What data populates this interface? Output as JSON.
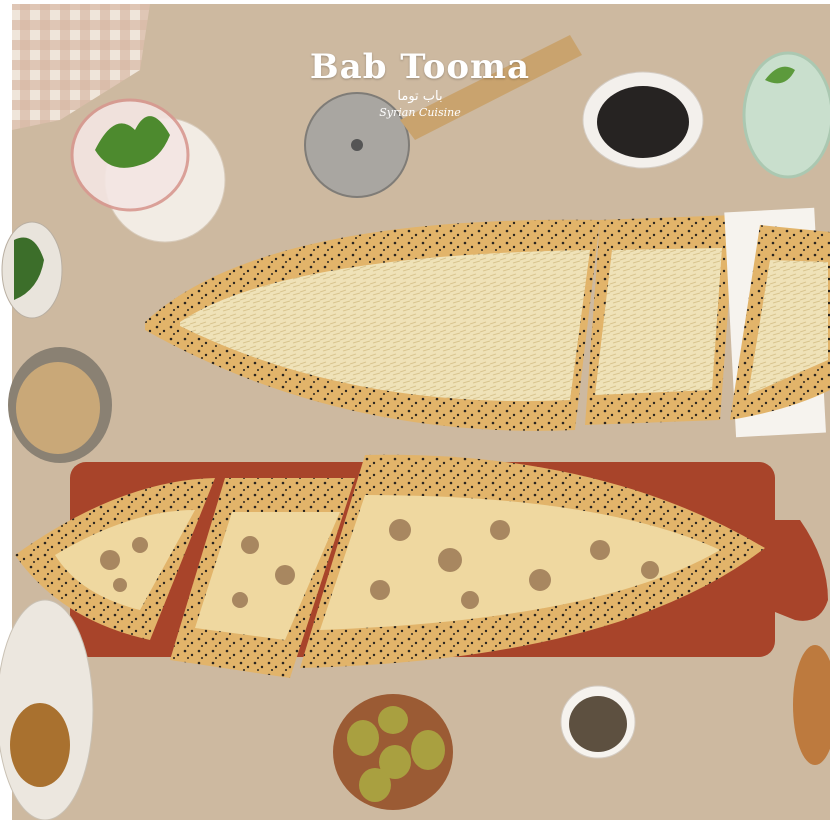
{
  "logo": {
    "brand": "Bab Tooma",
    "arabic": "باب توما",
    "subtitle": "Syrian Cuisine"
  },
  "colors": {
    "table": "#cdb9a0",
    "dough": "#e2b46a",
    "cheese": "#efe2b8",
    "board": "#a8442a"
  }
}
